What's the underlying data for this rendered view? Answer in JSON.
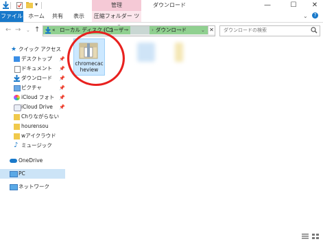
{
  "titlebar": {
    "manage_tab": "管理",
    "title": "ダウンロード",
    "minimize": "—",
    "maximize": "☐",
    "close": "✕"
  },
  "ribbon": {
    "tabs": [
      "ファイル",
      "ホーム",
      "共有",
      "表示",
      "圧縮フォルダー ツール"
    ]
  },
  "address": {
    "breadcrumbs": [
      "«",
      "ローカル ディスク (C:)",
      "ユーザー",
      "ダウンロード"
    ],
    "search_placeholder": "ダウンロードの検索"
  },
  "nav": {
    "items": [
      {
        "label": "クイック アクセス",
        "icon": "star-icon"
      },
      {
        "label": "デスクトップ",
        "icon": "desktop-icon"
      },
      {
        "label": "ドキュメント",
        "icon": "document-icon"
      },
      {
        "label": "ダウンロード",
        "icon": "download-icon"
      },
      {
        "label": "ピクチャ",
        "icon": "pictures-icon"
      },
      {
        "label": "iCloud フォト",
        "icon": "icloud-icon"
      },
      {
        "label": "iCloud Drive",
        "icon": "icloud-drive-icon"
      },
      {
        "label": "Chりながらない",
        "icon": "folder-icon"
      },
      {
        "label": "hourensou",
        "icon": "folder-icon"
      },
      {
        "label": "wアイクラウド",
        "icon": "folder-icon"
      },
      {
        "label": "ミュージック",
        "icon": "music-icon"
      },
      {
        "label": "OneDrive",
        "icon": "onedrive-icon"
      },
      {
        "label": "PC",
        "icon": "pc-icon"
      },
      {
        "label": "ネットワーク",
        "icon": "network-icon"
      }
    ]
  },
  "files": {
    "selected_name_line1": "chromecac",
    "selected_name_line2": "heview"
  },
  "colors": {
    "accent": "#1979ca",
    "manage_tab": "#f5c9d6",
    "address_fill": "#90d090",
    "selection": "#cce8ff",
    "highlight_circle": "#e8211f"
  }
}
